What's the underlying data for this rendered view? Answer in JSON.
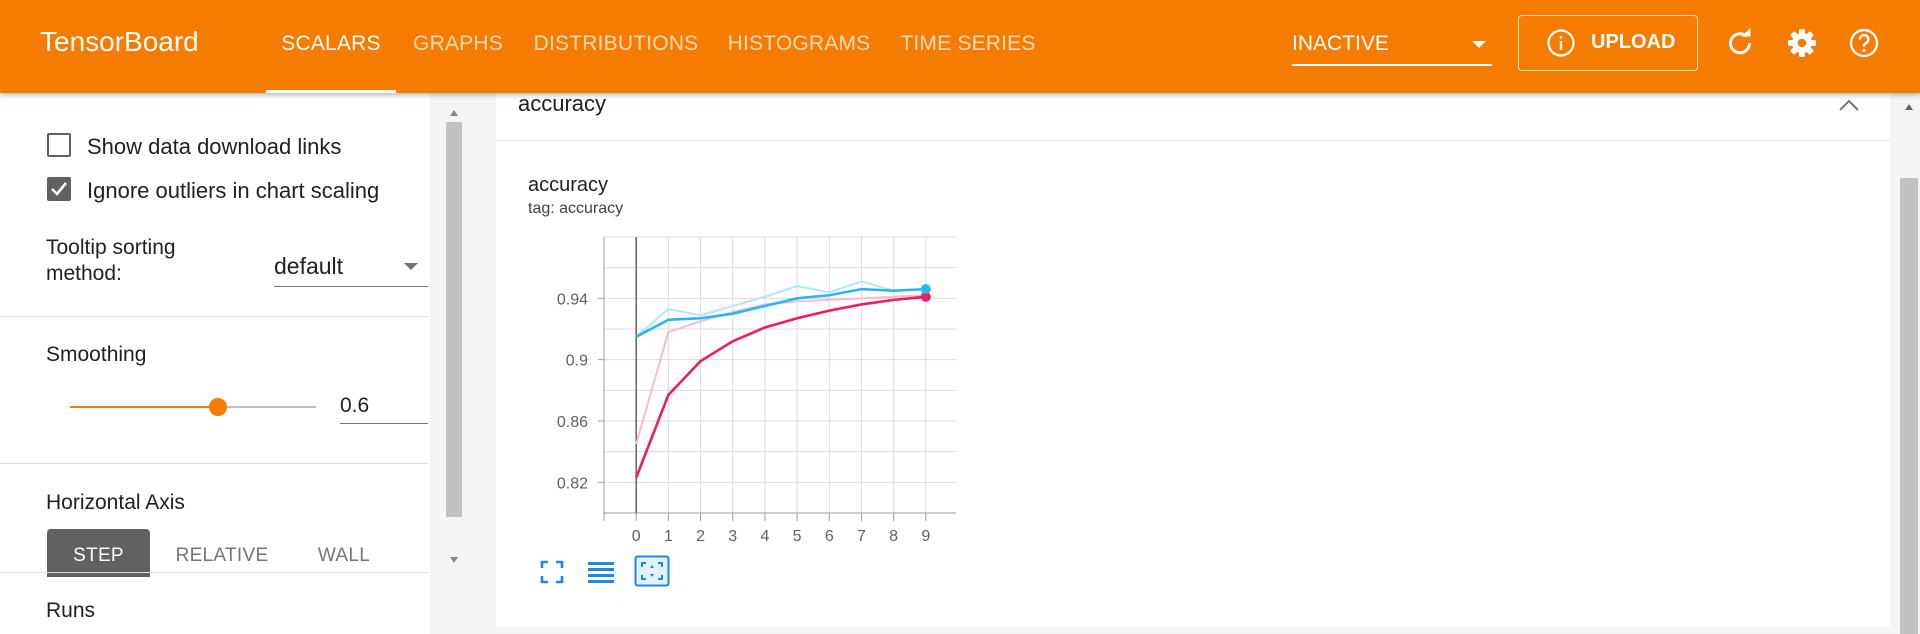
{
  "app": {
    "title": "TensorBoard"
  },
  "nav": {
    "tabs": [
      "SCALARS",
      "GRAPHS",
      "DISTRIBUTIONS",
      "HISTOGRAMS",
      "TIME SERIES"
    ],
    "active": "SCALARS"
  },
  "header": {
    "run_status": "INACTIVE",
    "upload_label": "UPLOAD",
    "icons": [
      "info-icon",
      "refresh-icon",
      "settings-icon",
      "help-icon"
    ]
  },
  "sidebar": {
    "show_download_links": {
      "label": "Show data download links",
      "checked": false
    },
    "ignore_outliers": {
      "label": "Ignore outliers in chart scaling",
      "checked": true
    },
    "tooltip_sorting": {
      "label_line1": "Tooltip sorting",
      "label_line2": "method:",
      "value": "default"
    },
    "smoothing": {
      "label": "Smoothing",
      "value": "0.6",
      "level": 0.6
    },
    "horizontal_axis": {
      "label": "Horizontal Axis",
      "options": [
        "STEP",
        "RELATIVE",
        "WALL"
      ],
      "selected": "STEP"
    },
    "runs": {
      "label": "Runs"
    }
  },
  "card": {
    "title": "accuracy"
  },
  "chart_data": {
    "type": "line",
    "title": "accuracy",
    "subtitle": "tag: accuracy",
    "x": [
      0,
      1,
      2,
      3,
      4,
      5,
      6,
      7,
      8,
      9
    ],
    "xlim": [
      -1,
      10
    ],
    "ylim": [
      0.8,
      0.98
    ],
    "y_ticks": [
      "0.82",
      "0.86",
      "0.9",
      "0.94"
    ],
    "x_ticks": [
      "0",
      "1",
      "2",
      "3",
      "4",
      "5",
      "6",
      "7",
      "8",
      "9"
    ],
    "grid": true,
    "series": [
      {
        "color": "#e91e63",
        "raw_color": "#f8bbd0",
        "smoothed": [
          0.823,
          0.877,
          0.899,
          0.912,
          0.921,
          0.927,
          0.932,
          0.936,
          0.939,
          0.941
        ],
        "raw": [
          0.845,
          0.918,
          0.925,
          0.931,
          0.936,
          0.938,
          0.939,
          0.94,
          0.941,
          0.942
        ]
      },
      {
        "color": "#29b6f6",
        "raw_color": "#b3e5fc",
        "smoothed": [
          0.915,
          0.926,
          0.927,
          0.93,
          0.935,
          0.94,
          0.942,
          0.946,
          0.945,
          0.946
        ],
        "raw": [
          0.915,
          0.933,
          0.929,
          0.935,
          0.941,
          0.948,
          0.944,
          0.951,
          0.945,
          0.946
        ]
      }
    ]
  },
  "chart_tools": [
    "fullscreen-icon",
    "toggle-log-scale-icon",
    "fit-domain-icon"
  ]
}
